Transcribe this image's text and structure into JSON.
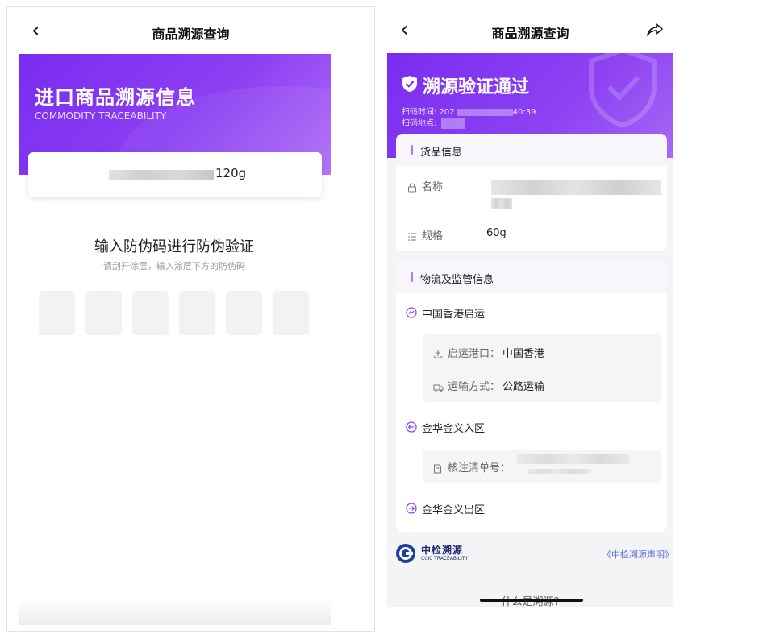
{
  "left_screen": {
    "nav": {
      "title": "商品溯源查询"
    },
    "hero": {
      "title": "进口商品溯源信息",
      "subtitle": "COMMODITY TRACEABILITY"
    },
    "product": {
      "weight": "120g"
    },
    "verify": {
      "title": "输入防伪码进行防伪验证",
      "hint": "请刮开涂层，输入涂层下方的防伪码",
      "code_box_count": 6
    }
  },
  "right_screen": {
    "nav": {
      "title": "商品溯源查询"
    },
    "hero": {
      "status": "溯源验证通过",
      "scan_time_label": "扫码时间:",
      "scan_time_visible": "202",
      "scan_time_tail": "40:39",
      "scan_place_label": "扫码地点:"
    },
    "goods_info": {
      "title": "货品信息",
      "name_label": "名称",
      "spec_label": "规格",
      "spec_value": "60g"
    },
    "logistics": {
      "title": "物流及监管信息",
      "stops": [
        {
          "label": "中国香港启运"
        },
        {
          "label": "金华金义入区"
        },
        {
          "label": "金华金义出区"
        }
      ],
      "departure_port_label": "启运港口：",
      "departure_port_value": "中国香港",
      "transport_label": "运输方式：",
      "transport_value": "公路运输",
      "filing_label": "核注清单号："
    },
    "footer": {
      "org_name": "中检溯源",
      "org_name_en": "CCIC TRACEABILITY",
      "statement_link": "《中检溯源声明》",
      "what_is": "什么是溯源?"
    }
  },
  "colors": {
    "brand_purple": "#7a2cf0",
    "link_blue": "#5b6be0"
  }
}
